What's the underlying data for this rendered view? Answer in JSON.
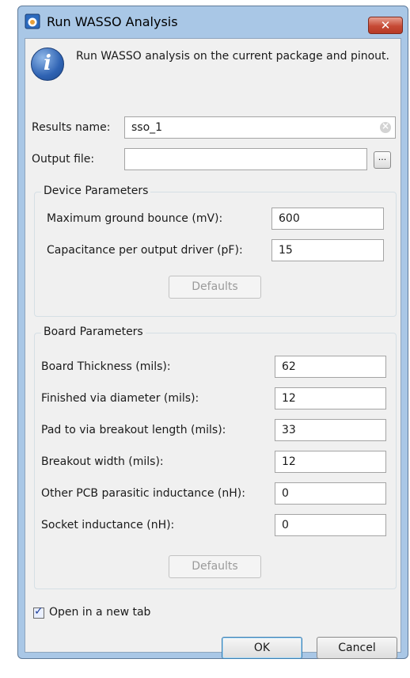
{
  "window": {
    "title": "Run WASSO Analysis",
    "close_glyph": "✕"
  },
  "info": {
    "icon": "info-icon",
    "glyph": "i",
    "text": "Run WASSO analysis on the current package and pinout."
  },
  "results": {
    "label": "Results name:",
    "value": "sso_1"
  },
  "output": {
    "label": "Output file:",
    "value": "",
    "browse_label": "..."
  },
  "device": {
    "title": "Device Parameters",
    "fields": [
      {
        "label": "Maximum ground bounce (mV):",
        "value": "600"
      },
      {
        "label": "Capacitance per output driver (pF):",
        "value": "15"
      }
    ],
    "defaults_label": "Defaults"
  },
  "board": {
    "title": "Board Parameters",
    "fields": [
      {
        "label": "Board Thickness (mils):",
        "value": "62"
      },
      {
        "label": "Finished via diameter (mils):",
        "value": "12"
      },
      {
        "label": "Pad to via breakout length (mils):",
        "value": "33"
      },
      {
        "label": "Breakout width (mils):",
        "value": "12"
      },
      {
        "label": "Other PCB parasitic inductance (nH):",
        "value": "0"
      },
      {
        "label": "Socket inductance (nH):",
        "value": "0"
      }
    ],
    "defaults_label": "Defaults"
  },
  "open_new_tab": {
    "label": "Open in a new tab",
    "checked": true
  },
  "buttons": {
    "ok": "OK",
    "cancel": "Cancel"
  },
  "colors": {
    "title_bar": "#a9c7e6",
    "client": "#f0f0f0",
    "close": "#c64a35",
    "accent": "#2f63b3"
  }
}
